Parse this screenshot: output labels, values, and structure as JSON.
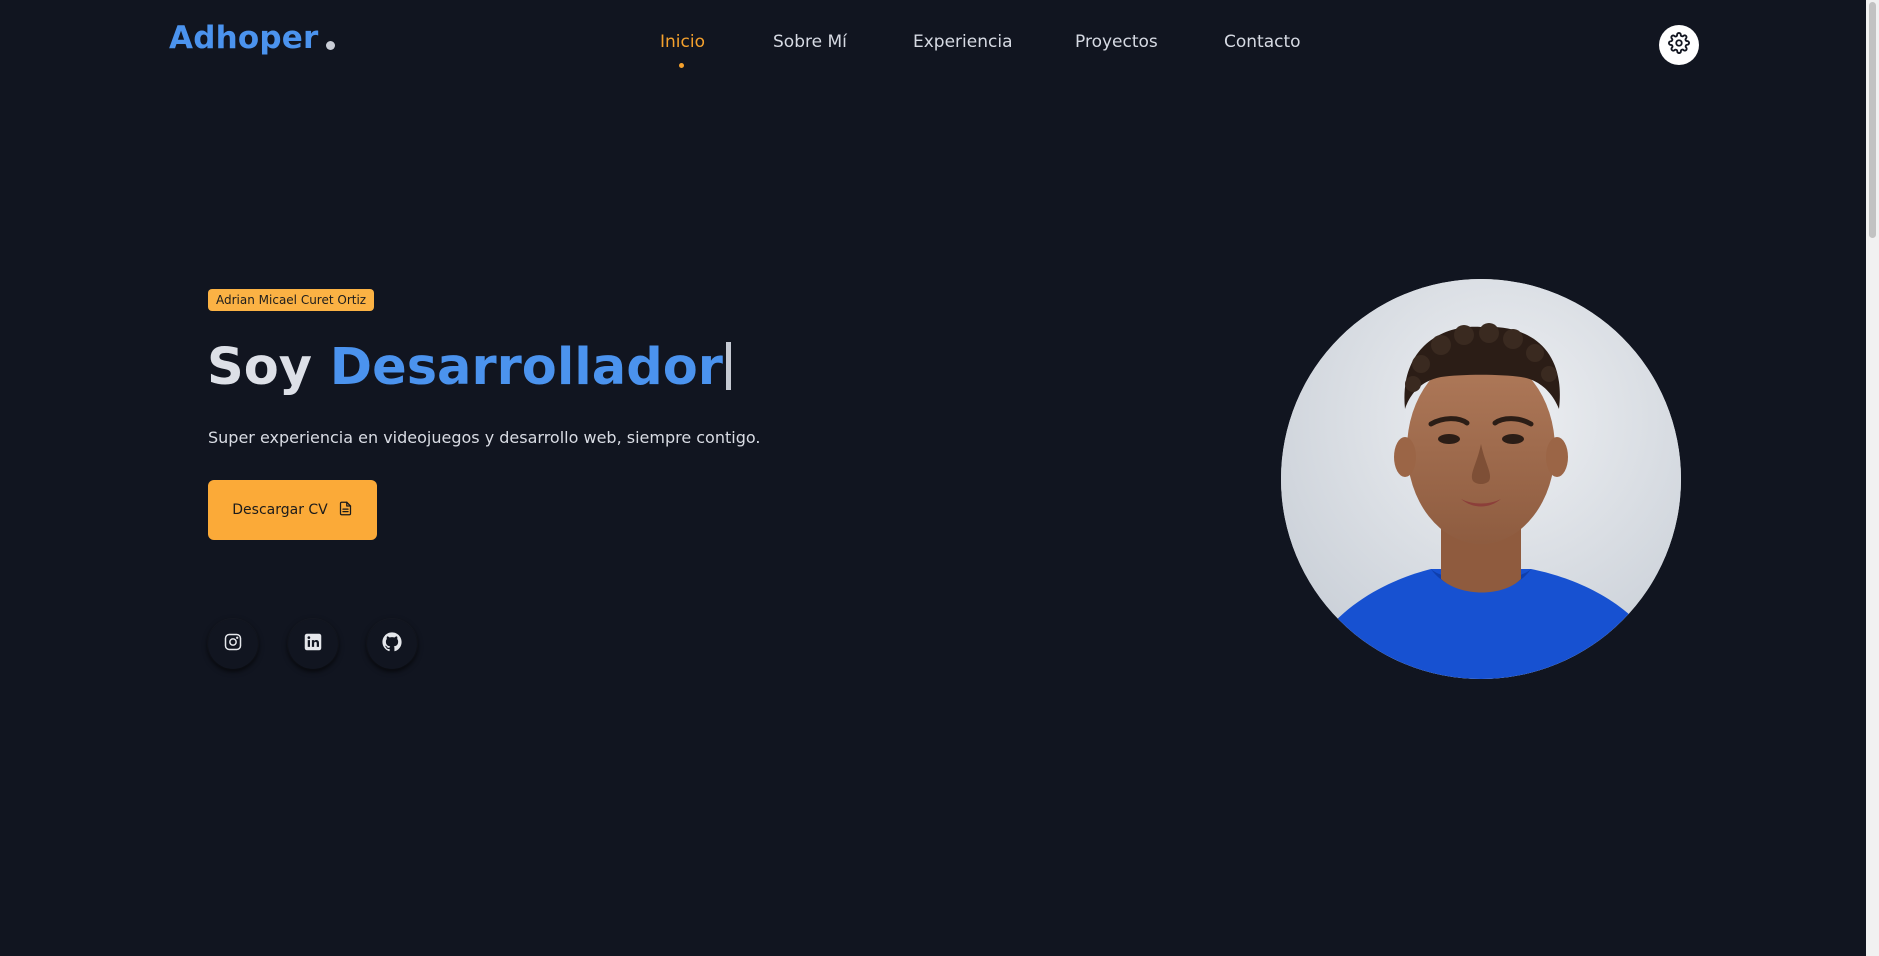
{
  "brand": {
    "name": "Adhoper"
  },
  "nav": {
    "items": [
      {
        "label": "Inicio",
        "active": true
      },
      {
        "label": "Sobre Mí",
        "active": false
      },
      {
        "label": "Experiencia",
        "active": false
      },
      {
        "label": "Proyectos",
        "active": false
      },
      {
        "label": "Contacto",
        "active": false
      }
    ],
    "theme_toggle_icon": "gear-icon"
  },
  "hero": {
    "badge": "Adrian Micael Curet Ortiz",
    "headline_prefix": "Soy",
    "headline_role": "Desarrollador",
    "tagline": "Super experiencia en videojuegos y desarrollo web, siempre contigo.",
    "cta_label": "Descargar CV",
    "cta_icon": "document-icon"
  },
  "social": [
    {
      "name": "Instagram",
      "icon": "instagram-icon"
    },
    {
      "name": "LinkedIn",
      "icon": "linkedin-icon"
    },
    {
      "name": "GitHub",
      "icon": "github-icon"
    }
  ],
  "colors": {
    "background": "#111520",
    "brand_blue": "#4b93ee",
    "accent_orange": "#f5a12d",
    "button_orange": "#fbaa38"
  }
}
